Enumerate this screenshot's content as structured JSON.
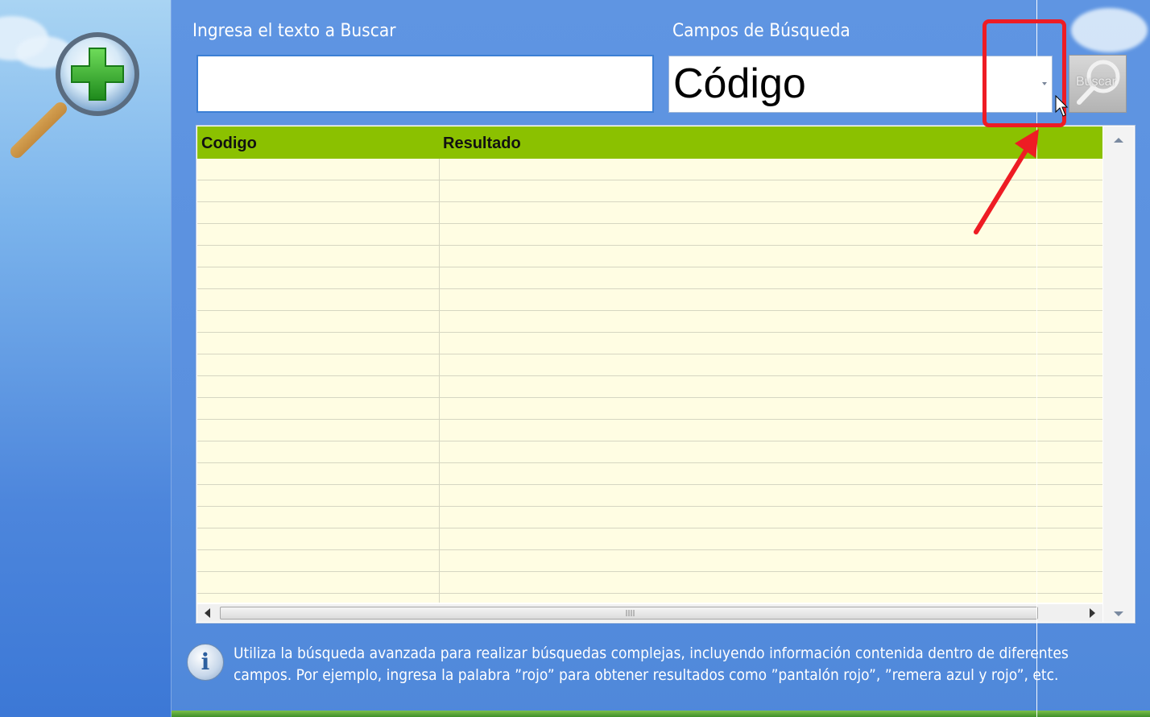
{
  "search": {
    "label": "Ingresa el texto a Buscar",
    "value": "",
    "placeholder": ""
  },
  "fields": {
    "label": "Campos de Búsqueda",
    "selected": "Código"
  },
  "buscar_button": {
    "label": "Buscar",
    "state": "disabled"
  },
  "results_grid": {
    "columns": [
      "Codigo",
      "Resultado"
    ],
    "rows": []
  },
  "info": {
    "line1": "Utiliza la búsqueda avanzada para realizar búsquedas complejas, incluyendo información contenida dentro de diferentes",
    "line2": "campos. Por ejemplo, ingresa la palabra ”rojo” para obtener resultados como ”pantalón rojo”, ”remera azul y rojo”, etc."
  },
  "icons": {
    "app_icon": "magnifier-plus-icon",
    "info_icon": "info-icon",
    "dropdown_arrow": "chevron-down-icon"
  },
  "colors": {
    "background": "#5d92df",
    "grid_header": "#8bc100",
    "grid_row": "#fffde3",
    "annotation": "#ee1c24"
  }
}
